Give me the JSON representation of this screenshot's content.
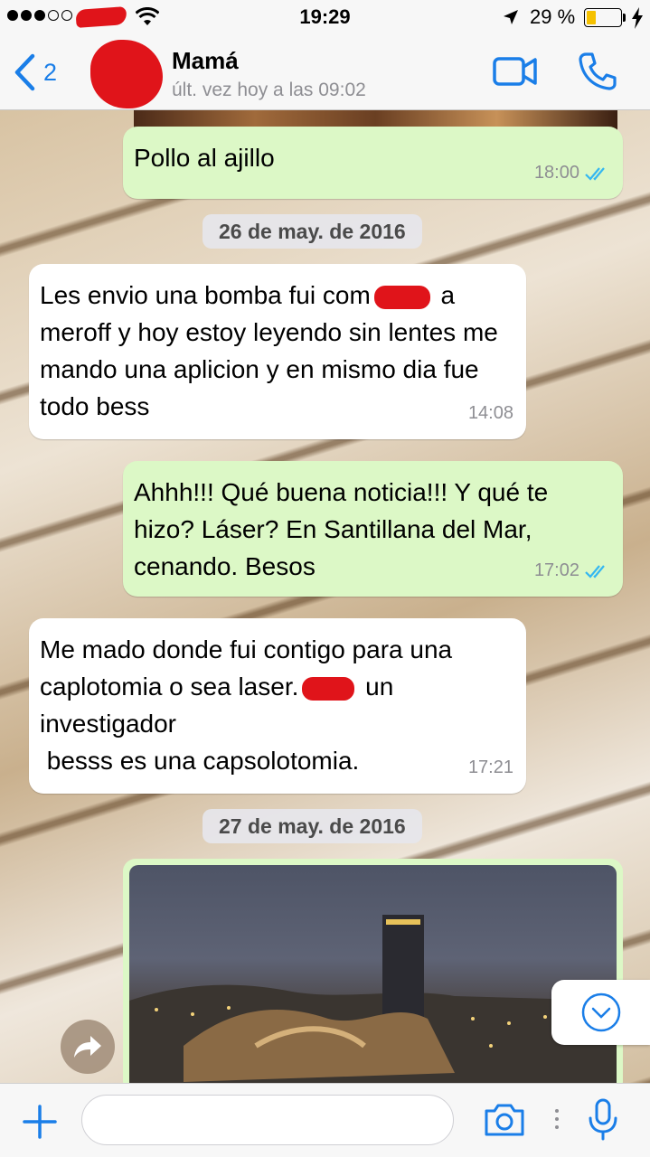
{
  "status_bar": {
    "time": "19:29",
    "battery_percent": "29 %",
    "battery_level": 0.29,
    "signal_bars": 3,
    "signal_total": 5
  },
  "header": {
    "back_count": "2",
    "contact_name": "Mamá",
    "last_seen": "últ. vez hoy a las 09:02",
    "icons": [
      "chevron-left-icon",
      "video-call-icon",
      "phone-icon"
    ]
  },
  "messages": [
    {
      "direction": "out",
      "text": "Pollo al ajillo",
      "time": "18:00",
      "read": true
    },
    {
      "type": "date",
      "text": "26 de may. de 2016"
    },
    {
      "direction": "in",
      "text_a": "Les envio una bomba fui com",
      "text_b": "a meroff y hoy estoy leyendo sin lentes me mando una aplicion y en mismo dia fue todo bess",
      "time": "14:08"
    },
    {
      "direction": "out",
      "text": "Ahhh!!! Qué buena noticia!!! Y qué te hizo? Láser? En Santillana del Mar, cenando. Besos",
      "time": "17:02",
      "read": true
    },
    {
      "direction": "in",
      "text_a": "Me mado donde fui contigo para una caplotomia o sea laser.",
      "text_b": "un investigador\n bесss es una capsolotomia.",
      "time": "17:21"
    },
    {
      "type": "date",
      "text": "27 de may. de 2016"
    },
    {
      "direction": "out",
      "type": "photo"
    }
  ],
  "input_bar": {
    "placeholder": "",
    "icons": [
      "plus-icon",
      "camera-icon",
      "microphone-icon"
    ]
  },
  "colors": {
    "accent": "#1a7ee8",
    "outgoing_bubble": "#dcf8c6",
    "incoming_bubble": "#ffffff",
    "read_ticks": "#34b7f1",
    "redaction": "#e0141a"
  }
}
